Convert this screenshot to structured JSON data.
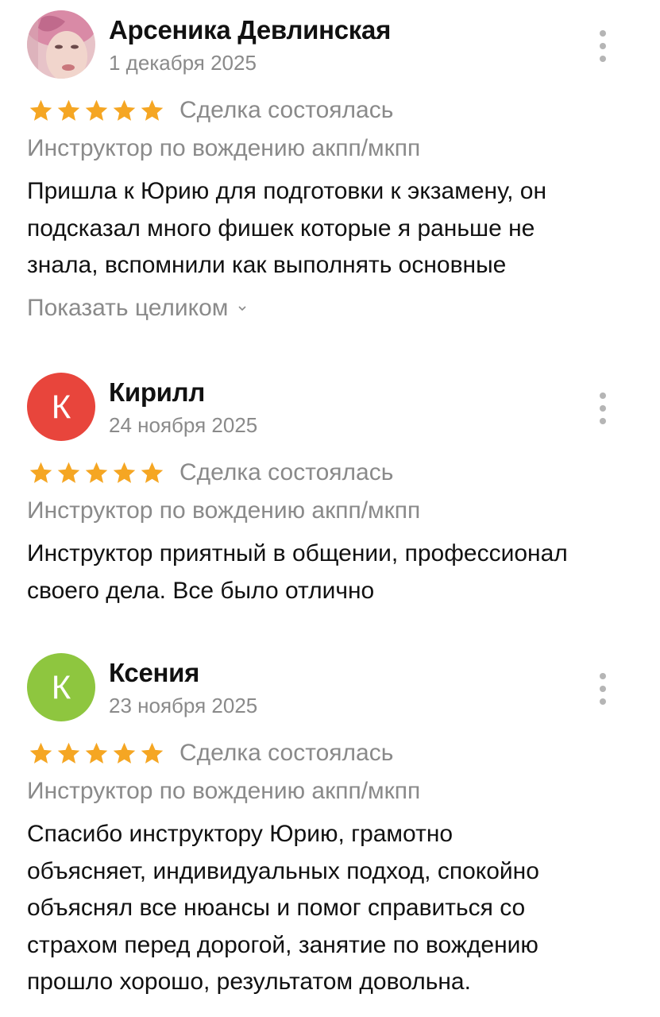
{
  "reviews": [
    {
      "author": "Арсеника Девлинская",
      "date": "1 декабря 2025",
      "avatar": {
        "type": "photo",
        "letter": ""
      },
      "rating": 5,
      "deal_status": "Сделка состоялась",
      "service": "Инструктор по вождению акпп/мкпп",
      "text_lines": [
        "Пришла к Юрию для подготовки к экзамену, он",
        "подсказал много фишек которые я раньше не",
        "знала, вспомнили как выполнять основные"
      ],
      "show_more": "Показать целиком"
    },
    {
      "author": "Кирилл",
      "date": "24 ноября 2025",
      "avatar": {
        "type": "letter",
        "letter": "К",
        "color": "#e8453c"
      },
      "rating": 5,
      "deal_status": "Сделка состоялась",
      "service": "Инструктор по вождению акпп/мкпп",
      "text_lines": [
        "Инструктор приятный в общении, профессионал",
        "своего дела. Все было отлично"
      ]
    },
    {
      "author": "Ксения",
      "date": "23 ноября 2025",
      "avatar": {
        "type": "letter",
        "letter": "К",
        "color": "#8ec63f"
      },
      "rating": 5,
      "deal_status": "Сделка состоялась",
      "service": "Инструктор по вождению акпп/мкпп",
      "text_lines": [
        "Спасибо инструктору Юрию, грамотно",
        "объясняет, индивидуальных подход, спокойно",
        "объяснял все нюансы и помог справиться со",
        "страхом перед дорогой, занятие по вождению",
        "прошло хорошо, результатом довольна."
      ]
    }
  ],
  "colors": {
    "star": "#f5a623",
    "muted_text": "#8a8a8a",
    "menu_dots": "#b5b5b5"
  },
  "icons": {
    "star": "star-icon",
    "menu": "more-vertical-icon",
    "chevron": "chevron-down-icon"
  }
}
